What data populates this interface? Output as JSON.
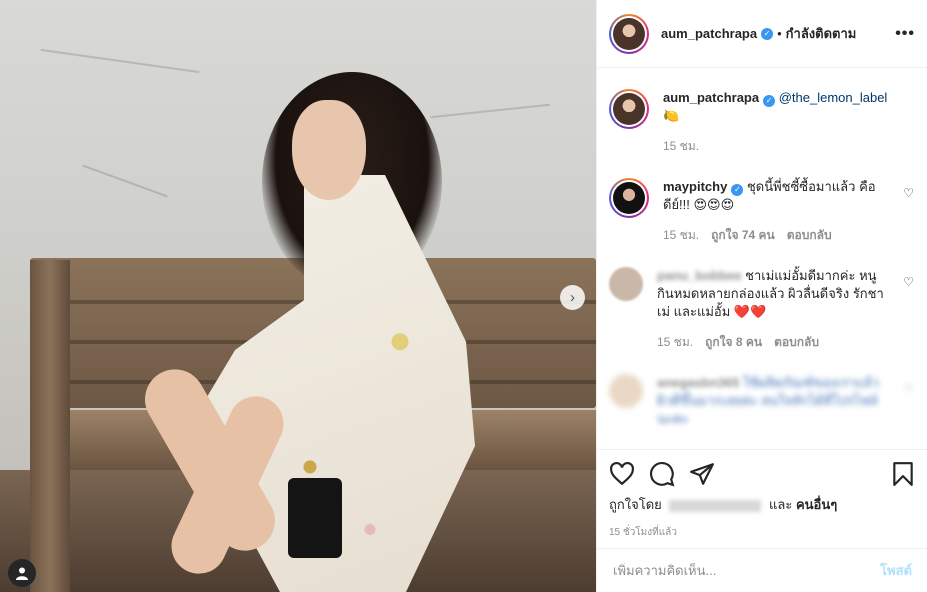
{
  "post": {
    "author": "aum_patchrapa",
    "following_label": "กำลังติดตาม",
    "more_label": "•••",
    "nav_next": "›"
  },
  "caption": {
    "username": "aum_patchrapa",
    "mention": "@the_lemon_label",
    "emoji": "🍋",
    "time": "15 ชม."
  },
  "comments": [
    {
      "username": "maypitchy",
      "text": "ชุดนี้พี่ชซี้ซื้อมาแล้ว คือดีย์!!! 😍😍😍",
      "time": "15 ชม.",
      "likes": "ถูกใจ 74 คน",
      "reply": "ตอบกลับ"
    },
    {
      "username": "panu_bobbee",
      "text": "ชาเม่แม่อั้มดีมากค่ะ หนูกินหมดหลายกล่องแล้ว ผิวลื่นดีจริง รักชาเม่ และแม่อั้ม ❤️❤️",
      "time": "15 ชม.",
      "likes": "ถูกใจ 8 คน",
      "reply": "ตอบกลับ"
    },
    {
      "username": "anegasbn365",
      "text": "ใช้ผลิตภัณฑ์ของเราแล้วผิวดีขึ้นมากเลยค่ะ สนใจทักได้ที่โปรไฟล์นะคะ",
      "time": "",
      "likes": "",
      "reply": ""
    }
  ],
  "likes_line": {
    "prefix": "ถูกใจโดย",
    "conj": "และ",
    "others": "คนอื่นๆ"
  },
  "post_time": "15 ชั่วโมงที่แล้ว",
  "add_comment": {
    "placeholder": "เพิ่มความคิดเห็น...",
    "post_label": "โพสต์"
  },
  "colors": {
    "verified": "#3897f0",
    "link": "#00376b",
    "post_button": "#b2dffc",
    "heart_red": "#ed4956"
  }
}
